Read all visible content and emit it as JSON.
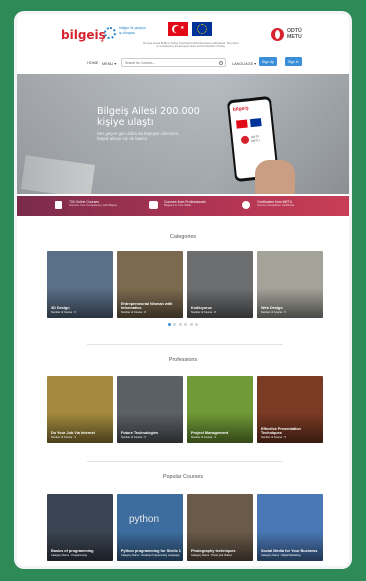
{
  "header": {
    "brand": "bilgeiş",
    "brand_tagline": "bilgiye ilk geçişin iş dünyası",
    "funding_text": "Bu proje Avrupa Birliği ve Türkiye Cumhuriyeti tarafından finanse edilmektedir. This project is co-financed by the European Union and the Republic of Turkey.",
    "odtu": "ODTÜ",
    "metu": "METU"
  },
  "nav": {
    "home": "HOME",
    "menu": "MENU ▾",
    "search_placeholder": "Search for Courses...",
    "language": "LANGUAGE ▾",
    "sign_up": "Sign Up",
    "sign_in": "Sign In"
  },
  "hero": {
    "title": "Bilgeiş Ailesi 200.000 kişiye ulaştı",
    "subtitle": "Her geçen gün daha da büyüyen ailemize, büyük aileye siz de katılın.",
    "phone_brand": "bilgeiş"
  },
  "features": [
    {
      "title": "700 Online Courses",
      "subtitle": "Improve Your Competency with Bilgeiş"
    },
    {
      "title": "Courses from Professionals",
      "subtitle": "Bilgeiş For Your Skills"
    },
    {
      "title": "Certificates from METU",
      "subtitle": "Course Completion Certificate"
    }
  ],
  "categories": {
    "title": "Categories",
    "items": [
      {
        "title": "3D Design",
        "sub": "Number of Course : 6",
        "color": "#5a7088"
      },
      {
        "title": "Entrepreneurial Woman with Informatics",
        "sub": "Number of Course : 8",
        "color": "#7b6a4f"
      },
      {
        "title": "Kodluyoruz",
        "sub": "Number of Course : 8",
        "color": "#6d6e70"
      },
      {
        "title": "Web Design",
        "sub": "Number of Course : 5",
        "color": "#a3a39a"
      }
    ],
    "dots": 6,
    "active": 0
  },
  "professions": {
    "title": "Professions",
    "items": [
      {
        "title": "Do Your Job Via Internet",
        "sub": "Number of Course : 3",
        "color": "#a38a3c"
      },
      {
        "title": "Future Technologies",
        "sub": "Number of Course : 5",
        "color": "#5b6066"
      },
      {
        "title": "Project Management",
        "sub": "Number of Course : 4",
        "color": "#6f9a35"
      },
      {
        "title": "Effective Presentation Techniques",
        "sub": "Number of Course : 5",
        "color": "#7a3a24"
      }
    ]
  },
  "popular": {
    "title": "Popular Courses",
    "items": [
      {
        "title": "Basics of programming",
        "sub": "Category Name : Programming",
        "color": "#3b4452"
      },
      {
        "title": "Python programming for Shells 1",
        "sub": "Category Name : Desktop Programming Language",
        "color": "#3d6d9e",
        "logo": "python"
      },
      {
        "title": "Photography techniques",
        "sub": "Category Name : Photo and Videos",
        "color": "#6a5a4a"
      },
      {
        "title": "Social Media for Your Business",
        "sub": "Category Name : Digital Marketing",
        "color": "#4a78b6"
      }
    ],
    "dots": 3,
    "active": 0
  }
}
